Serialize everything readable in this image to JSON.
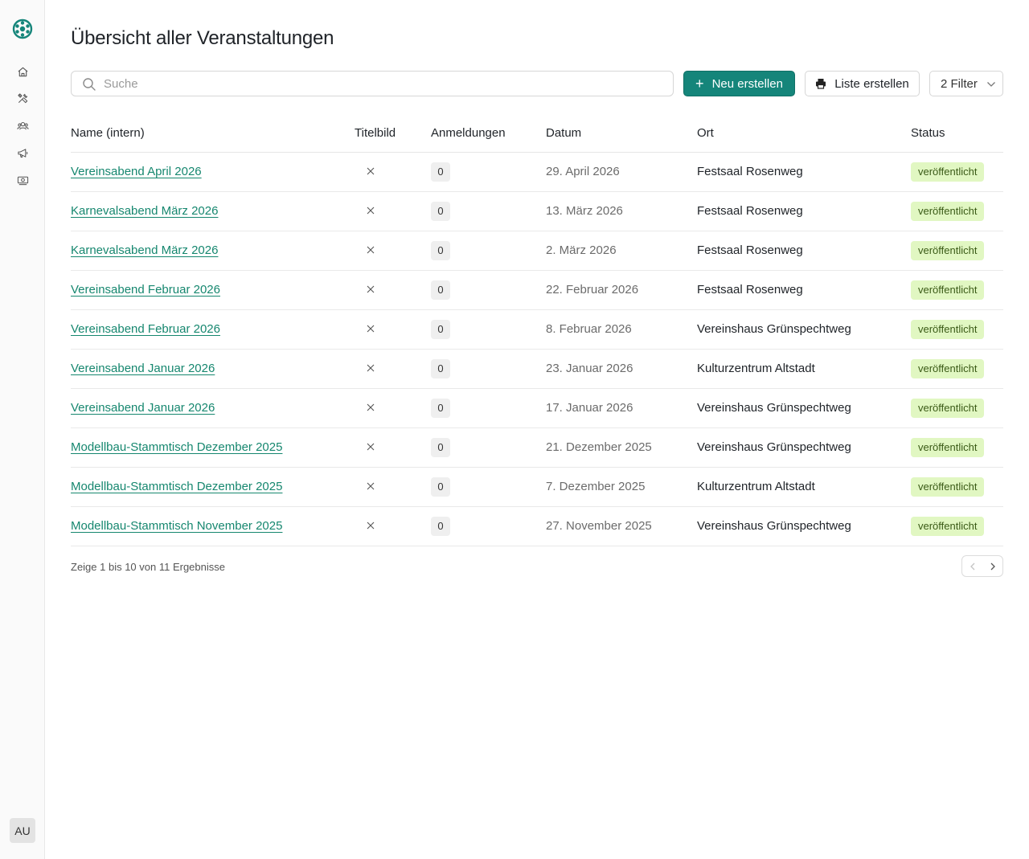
{
  "app": {
    "user_initials": "AU",
    "accent_color": "#15857a",
    "logo_icon": "club-logo-icon",
    "nav": [
      {
        "name": "home",
        "icon": "home-icon"
      },
      {
        "name": "tools",
        "icon": "tools-icon"
      },
      {
        "name": "members",
        "icon": "users-icon"
      },
      {
        "name": "announcements",
        "icon": "megaphone-icon"
      },
      {
        "name": "finances",
        "icon": "money-icon"
      }
    ]
  },
  "page": {
    "title": "Übersicht aller Veranstaltungen"
  },
  "toolbar": {
    "search_placeholder": "Suche",
    "search_value": "",
    "create_label": "Neu erstellen",
    "create_icon": "+",
    "print_list_label": "Liste erstellen",
    "filter_label": "2 Filter"
  },
  "table": {
    "columns": [
      "Name (intern)",
      "Titelbild",
      "Anmeldungen",
      "Datum",
      "Ort",
      "Status"
    ],
    "rows": [
      {
        "name": "Vereinsabend April 2026",
        "titelbild": "none",
        "anmeldungen": "0",
        "datum": "29. April 2026",
        "ort": "Festsaal Rosenweg",
        "status": "veröffentlicht"
      },
      {
        "name": "Karnevalsabend März 2026",
        "titelbild": "none",
        "anmeldungen": "0",
        "datum": "13. März 2026",
        "ort": "Festsaal Rosenweg",
        "status": "veröffentlicht"
      },
      {
        "name": "Karnevalsabend März 2026",
        "titelbild": "none",
        "anmeldungen": "0",
        "datum": "2. März 2026",
        "ort": "Festsaal Rosenweg",
        "status": "veröffentlicht"
      },
      {
        "name": "Vereinsabend Februar 2026",
        "titelbild": "none",
        "anmeldungen": "0",
        "datum": "22. Februar 2026",
        "ort": "Festsaal Rosenweg",
        "status": "veröffentlicht"
      },
      {
        "name": "Vereinsabend Februar 2026",
        "titelbild": "none",
        "anmeldungen": "0",
        "datum": "8. Februar 2026",
        "ort": "Vereinshaus Grünspechtweg",
        "status": "veröffentlicht"
      },
      {
        "name": "Vereinsabend Januar 2026",
        "titelbild": "none",
        "anmeldungen": "0",
        "datum": "23. Januar 2026",
        "ort": "Kulturzentrum Altstadt",
        "status": "veröffentlicht"
      },
      {
        "name": "Vereinsabend Januar 2026",
        "titelbild": "none",
        "anmeldungen": "0",
        "datum": "17. Januar 2026",
        "ort": "Vereinshaus Grünspechtweg",
        "status": "veröffentlicht"
      },
      {
        "name": "Modellbau-Stammtisch Dezember 2025",
        "titelbild": "none",
        "anmeldungen": "0",
        "datum": "21. Dezember 2025",
        "ort": "Vereinshaus Grünspechtweg",
        "status": "veröffentlicht"
      },
      {
        "name": "Modellbau-Stammtisch Dezember 2025",
        "titelbild": "none",
        "anmeldungen": "0",
        "datum": "7. Dezember 2025",
        "ort": "Kulturzentrum Altstadt",
        "status": "veröffentlicht"
      },
      {
        "name": "Modellbau-Stammtisch November 2025",
        "titelbild": "none",
        "anmeldungen": "0",
        "datum": "27. November 2025",
        "ort": "Vereinshaus Grünspechtweg",
        "status": "veröffentlicht"
      }
    ]
  },
  "pagination": {
    "summary": "Zeige 1 bis 10 von 11 Ergebnisse",
    "prev_icon": "chevron-left-icon",
    "next_icon": "chevron-right-icon",
    "prev_enabled": false,
    "next_enabled": true
  }
}
